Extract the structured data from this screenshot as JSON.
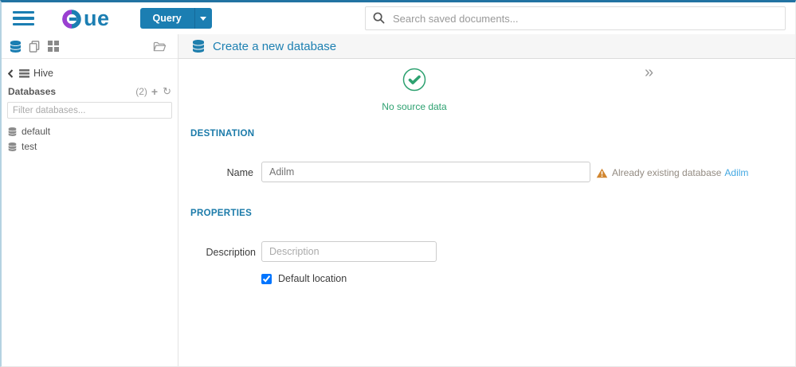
{
  "topbar": {
    "logo_text": "ue",
    "query_button_label": "Query",
    "search_placeholder": "Search saved documents..."
  },
  "assist": {
    "source_name": "Hive",
    "databases_label": "Databases",
    "databases_count": "(2)",
    "plus_glyph": "+",
    "refresh_glyph": "↻",
    "filter_placeholder": "Filter databases...",
    "databases": [
      "default",
      "test"
    ]
  },
  "main": {
    "title": "Create a new database",
    "status_text": "No source data",
    "skip_glyph": "»",
    "destination_heading": "DESTINATION",
    "name_label": "Name",
    "name_value": "Adilm",
    "warning_text": "Already existing database",
    "warning_link_text": "Adilm",
    "properties_heading": "PROPERTIES",
    "description_label": "Description",
    "description_placeholder": "Description",
    "default_location_label": "Default location",
    "default_location_checked": true
  },
  "colors": {
    "brand_blue": "#1b7eb2",
    "title_blue": "#1d80b2",
    "link_blue": "#43a8e2",
    "success_green": "#2da170",
    "warning_orange": "#d1862f"
  }
}
